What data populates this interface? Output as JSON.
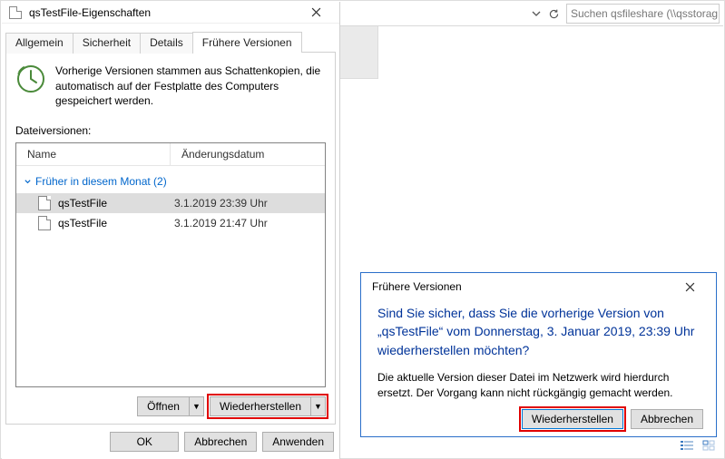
{
  "explorer": {
    "search_placeholder": "Suchen qsfileshare (\\\\qsstorag...",
    "dropdown_icon": "chevron-down",
    "refresh_icon": "refresh"
  },
  "props": {
    "title": "qsTestFile-Eigenschaften",
    "tabs": {
      "general": "Allgemein",
      "security": "Sicherheit",
      "details": "Details",
      "previous": "Frühere Versionen"
    },
    "description": "Vorherige Versionen stammen aus Schattenkopien, die automatisch auf der Festplatte des Computers gespeichert werden.",
    "versions_label": "Dateiversionen:",
    "columns": {
      "name": "Name",
      "date": "Änderungsdatum"
    },
    "group_header": "Früher in diesem Monat (2)",
    "files": [
      {
        "name": "qsTestFile",
        "date": "3.1.2019 23:39 Uhr",
        "selected": true
      },
      {
        "name": "qsTestFile",
        "date": "3.1.2019 21:47 Uhr",
        "selected": false
      }
    ],
    "actions": {
      "open": "Öffnen",
      "restore": "Wiederherstellen"
    },
    "buttons": {
      "ok": "OK",
      "cancel": "Abbrechen",
      "apply": "Anwenden"
    }
  },
  "confirm": {
    "title": "Frühere Versionen",
    "main": "Sind Sie sicher, dass Sie die vorherige Version von „qsTestFile“ vom Donnerstag, 3. Januar 2019, 23:39 Uhr wiederherstellen möchten?",
    "body": "Die aktuelle Version dieser Datei im Netzwerk wird hierdurch ersetzt. Der Vorgang kann nicht rückgängig gemacht werden.",
    "buttons": {
      "restore": "Wiederherstellen",
      "cancel": "Abbrechen"
    }
  }
}
